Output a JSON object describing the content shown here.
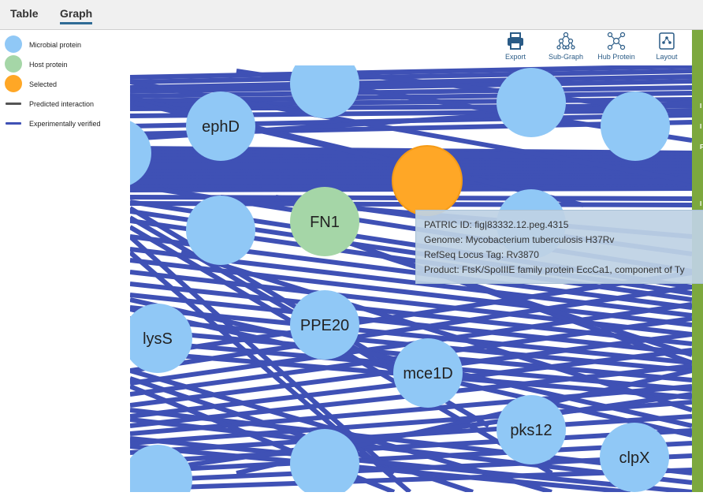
{
  "tabs": [
    {
      "label": "Table",
      "active": false
    },
    {
      "label": "Graph",
      "active": true
    }
  ],
  "legend": [
    {
      "label": "Microbial protein",
      "color": "#90c8f6",
      "shape": "circle"
    },
    {
      "label": "Host protein",
      "color": "#a5d6a7",
      "shape": "circle"
    },
    {
      "label": "Selected",
      "color": "#ffa726",
      "shape": "circle"
    },
    {
      "label": "Predicted interaction",
      "color": "#555555",
      "shape": "line"
    },
    {
      "label": "Experimentally verified",
      "color": "#3f51b5",
      "shape": "line"
    }
  ],
  "toolbar": {
    "export_label": "Export",
    "subgraph_label": "Sub-Graph",
    "hub_label": "Hub Protein",
    "layout_label": "Layout"
  },
  "colors": {
    "edge": "#3f51b5",
    "microbial": "#90c8f6",
    "host": "#a5d6a7",
    "selected": "#ffa726",
    "side_bar": "#7ca83e"
  },
  "nodes": [
    {
      "label": "",
      "type": "microbial"
    },
    {
      "label": "ephD",
      "type": "microbial"
    },
    {
      "label": "",
      "type": "microbial"
    },
    {
      "label": "",
      "type": "microbial"
    },
    {
      "label": "",
      "type": "selected"
    },
    {
      "label": "",
      "type": "microbial"
    },
    {
      "label": "",
      "type": "microbial"
    },
    {
      "label": "FN1",
      "type": "host"
    },
    {
      "label": "",
      "type": "microbial"
    },
    {
      "label": "lysS",
      "type": "microbial"
    },
    {
      "label": "PPE20",
      "type": "microbial"
    },
    {
      "label": "mce1D",
      "type": "microbial"
    },
    {
      "label": "pks12",
      "type": "microbial"
    },
    {
      "label": "clpX",
      "type": "microbial"
    },
    {
      "label": "",
      "type": "microbial"
    },
    {
      "label": "",
      "type": "microbial"
    }
  ],
  "tooltip": {
    "patric_id": "PATRIC ID: fig|83332.12.peg.4315",
    "genome": "Genome: Mycobacterium tuberculosis H37Rv",
    "refseq": "RefSeq Locus Tag: Rv3870",
    "product": "Product: FtsK/SpoIIIE family protein EccCa1, component of Ty"
  },
  "side_bar_chars": [
    "I",
    "I",
    "F",
    "I"
  ]
}
